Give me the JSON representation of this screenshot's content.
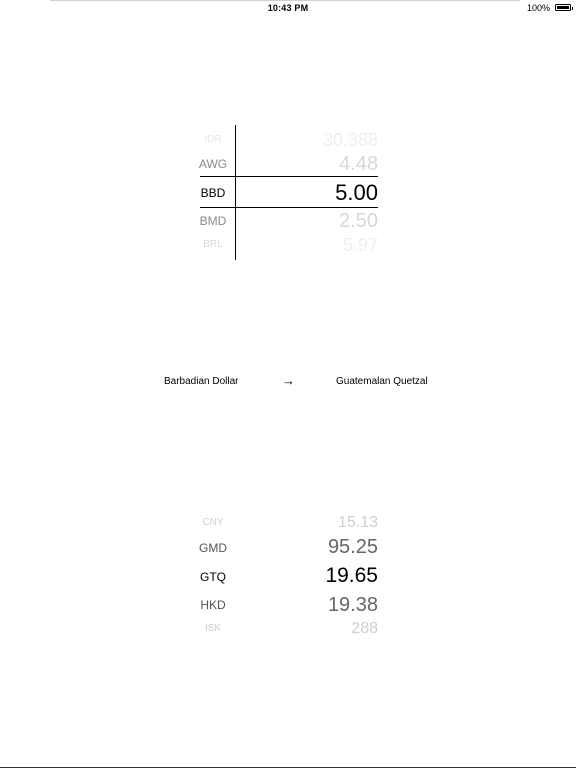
{
  "status_bar": {
    "time": "10:43 PM",
    "battery": "100%"
  },
  "top_picker": {
    "rows": [
      {
        "code": "IDR",
        "value": "30,388"
      },
      {
        "code": "AWG",
        "value": "4.48"
      },
      {
        "code": "BBD",
        "value": "5.00"
      },
      {
        "code": "BMD",
        "value": "2.50"
      },
      {
        "code": "BRL",
        "value": "5.97"
      }
    ]
  },
  "conversion": {
    "from": "Barbadian Dollar",
    "arrow": "→",
    "to": "Guatemalan Quetzal"
  },
  "bottom_picker": {
    "rows": [
      {
        "code": "CNY",
        "value": "15.13"
      },
      {
        "code": "GMD",
        "value": "95.25"
      },
      {
        "code": "GTQ",
        "value": "19.65"
      },
      {
        "code": "HKD",
        "value": "19.38"
      },
      {
        "code": "ISK",
        "value": "288"
      }
    ]
  }
}
